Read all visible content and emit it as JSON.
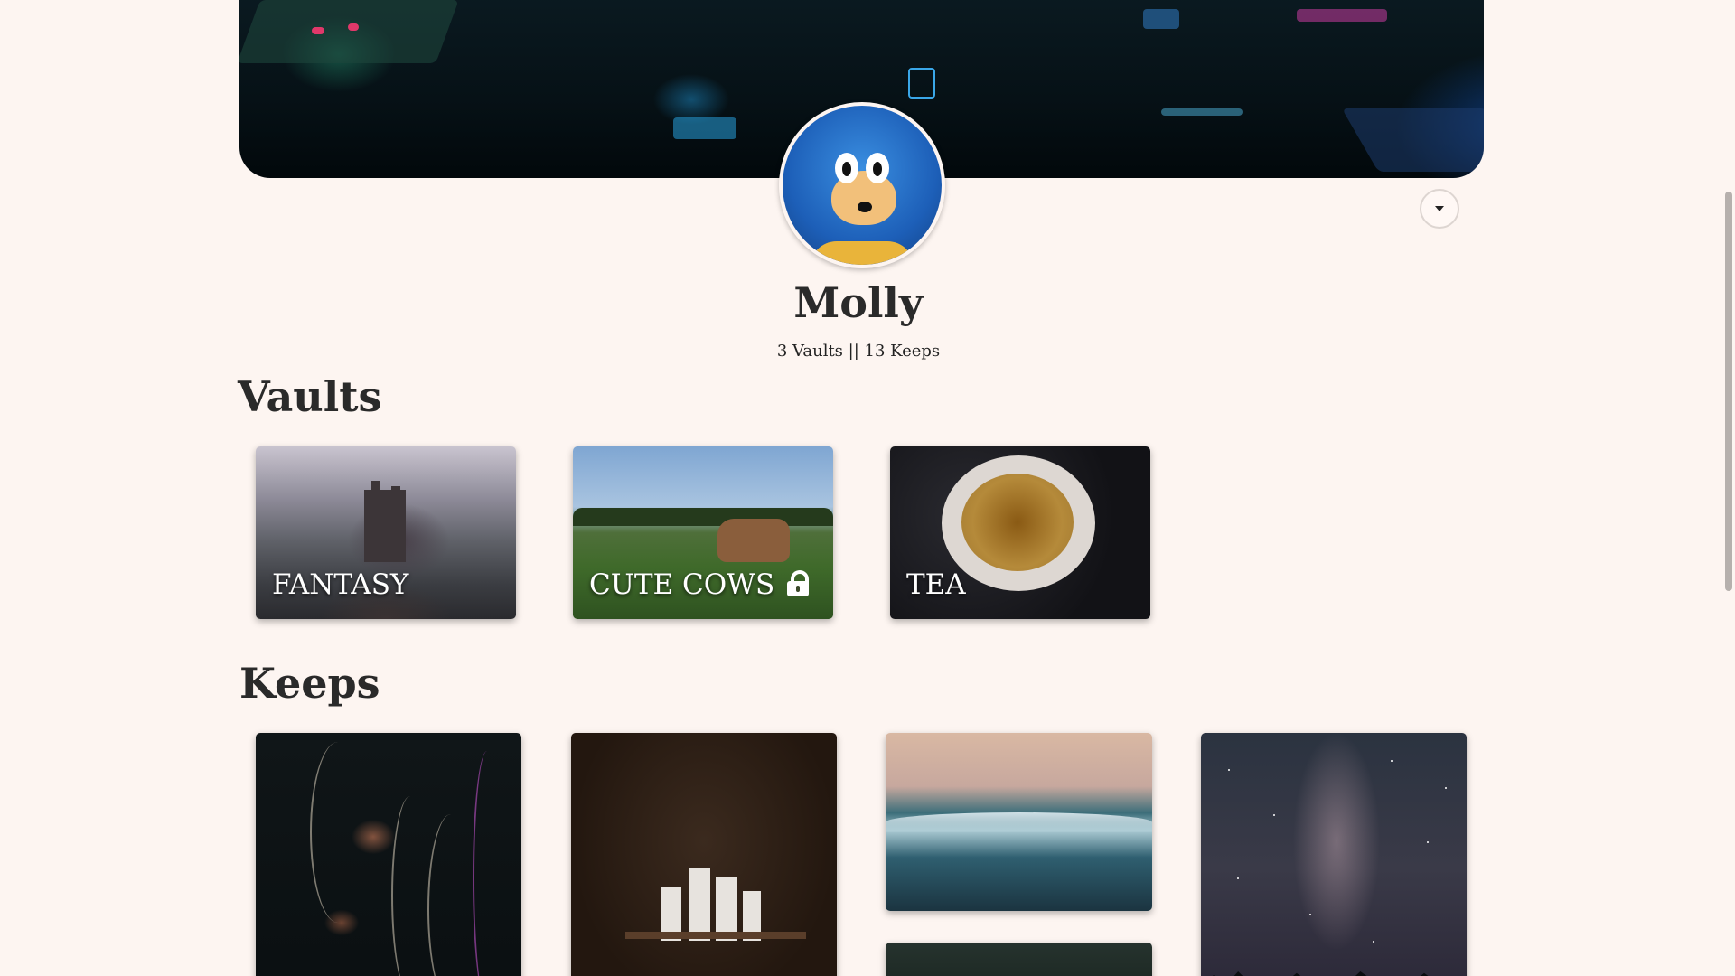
{
  "profile": {
    "name": "Molly",
    "stats": "3 Vaults || 13 Keeps"
  },
  "sections": {
    "vaults_title": "Vaults",
    "keeps_title": "Keeps"
  },
  "vaults": [
    {
      "label": "FANTASY",
      "private": false
    },
    {
      "label": "CUTE COWS",
      "private": true
    },
    {
      "label": "TEA",
      "private": false
    }
  ],
  "keeps": [
    {
      "image": "jellyfish"
    },
    {
      "image": "model-ship"
    },
    {
      "image": "ocean-waves"
    },
    {
      "image": "forest-canopy"
    },
    {
      "image": "milky-way"
    }
  ],
  "icons": {
    "menu": "caret-down-icon",
    "lock": "lock-icon"
  },
  "colors": {
    "background": "#fdf5f1",
    "text": "#2a2a2a"
  }
}
